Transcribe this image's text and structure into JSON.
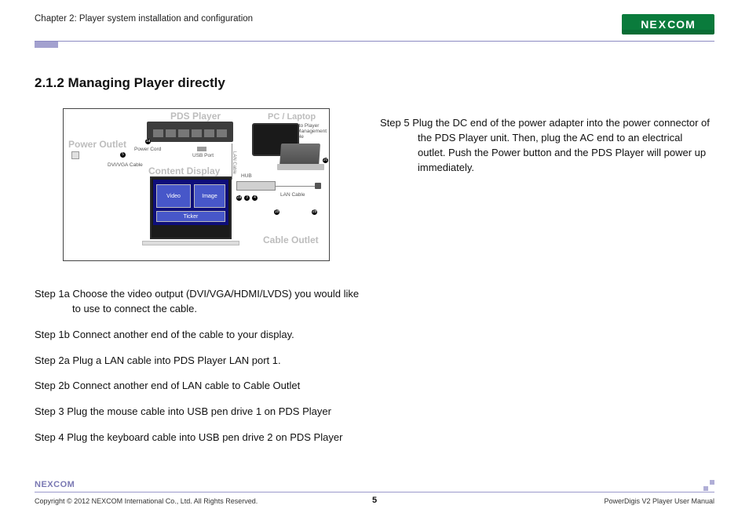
{
  "header": {
    "chapter": "Chapter 2: Player system installation and configuration",
    "logo_text_pre": "NE",
    "logo_text_x": "X",
    "logo_text_post": "COM"
  },
  "section": {
    "title": "2.1.2 Managing Player directly"
  },
  "diagram": {
    "labels": {
      "pds_player": "PDS Player",
      "pc_laptop": "PC / Laptop",
      "power_outlet": "Power Outlet",
      "content_display": "Content Display",
      "cable_outlet": "Cable Outlet"
    },
    "small": {
      "login": "Login to Player Web Management Console",
      "power_cord": "Power Cord",
      "dvi_vga": "DVI/VGA Cable",
      "usb_port": "USB Port",
      "lan_cable_v": "LAN Cable",
      "hub": "HUB",
      "lan_cable": "LAN Cable"
    },
    "tiles": {
      "video": "Video",
      "image": "Image",
      "ticker": "Ticker"
    }
  },
  "steps": {
    "s1a": "Step 1a Choose the video output (DVI/VGA/HDMI/LVDS) you would like to use to connect the cable.",
    "s1b": "Step 1b Connect another end of the cable to your display.",
    "s2a": "Step 2a Plug a LAN cable into PDS Player LAN port 1.",
    "s2b": "Step 2b Connect another end of LAN cable to Cable Outlet",
    "s3": "Step 3 Plug the mouse cable into USB pen drive 1 on PDS Player",
    "s4": "Step 4 Plug the keyboard cable into USB pen drive 2 on PDS Player",
    "s5": "Step 5 Plug the DC end of the power adapter into the power connector of the PDS Player unit. Then, plug the AC end to an electrical outlet. Push the Power button and the PDS Player will power up immediately."
  },
  "footer": {
    "logo_pre": "NE",
    "logo_x": "X",
    "logo_post": "COM",
    "copyright": "Copyright © 2012 NEXCOM International Co., Ltd. All Rights Reserved.",
    "page": "5",
    "manual": "PowerDigis V2 Player User Manual"
  }
}
